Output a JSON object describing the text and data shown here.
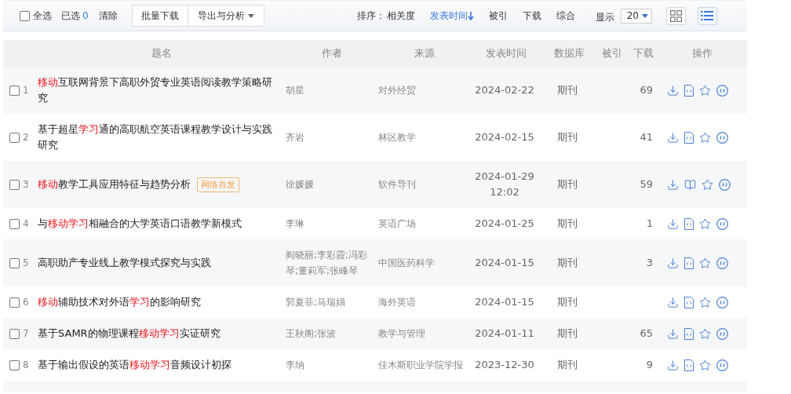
{
  "toolbar": {
    "select_all": {
      "label": "全选",
      "checked": false
    },
    "selected_label": "已选",
    "selected_count": "0",
    "clear": "清除",
    "buttons": [
      {
        "label": "批量下载",
        "kind": "plain"
      },
      {
        "label": "导出与分析",
        "kind": "dropdown"
      }
    ],
    "sort": {
      "label": "排序：",
      "options": [
        {
          "label": "相关度",
          "selected": false
        },
        {
          "label": "发表时间",
          "selected": true
        },
        {
          "label": "被引",
          "selected": false
        },
        {
          "label": "下载",
          "selected": false
        },
        {
          "label": "综合",
          "selected": false
        }
      ]
    },
    "display": {
      "label": "显示",
      "value": "20"
    },
    "views": [
      {
        "kind": "grid",
        "selected": false
      },
      {
        "kind": "list",
        "selected": true
      }
    ]
  },
  "table": {
    "columns": [
      "题名",
      "作者",
      "来源",
      "发表时间",
      "数据库",
      "被引",
      "下载",
      "操作"
    ],
    "rows": [
      {
        "number": "1",
        "checked": false,
        "kind": "html",
        "title": [
          {
            "text": "移动",
            "highlight": true
          },
          {
            "text": "互联网背景下高职外贸专业英语阅读教学策略研究",
            "highlight": false
          }
        ],
        "author": "胡星",
        "source": "对外经贸",
        "date": "2024-02-22",
        "database": "期刊",
        "downloads": "69"
      },
      {
        "number": "2",
        "checked": false,
        "kind": "html",
        "title": [
          {
            "text": "基于超星",
            "highlight": false
          },
          {
            "text": "学习",
            "highlight": true
          },
          {
            "text": "通的高职航空英语课程教学设计与实践研究",
            "highlight": false
          }
        ],
        "author": "齐岩",
        "source": "林区教学",
        "date": "2024-02-15",
        "database": "期刊",
        "downloads": "41"
      },
      {
        "number": "3",
        "checked": false,
        "kind": "book",
        "title": [
          {
            "text": "移动",
            "highlight": true
          },
          {
            "text": "教学工具应用特征与趋势分析",
            "highlight": false
          }
        ],
        "badge": "网络首发",
        "author": "徐媛媛",
        "source": "软件导刊",
        "date": "2024-01-29 12:02",
        "database": "期刊",
        "downloads": "59"
      },
      {
        "number": "4",
        "checked": false,
        "kind": "html",
        "title": [
          {
            "text": "与",
            "highlight": false
          },
          {
            "text": "移动学习",
            "highlight": true
          },
          {
            "text": "相融合的大学英语口语教学新模式",
            "highlight": false
          }
        ],
        "author": "李琳",
        "source": "英语广场",
        "date": "2024-01-25",
        "database": "期刊",
        "downloads": "1"
      },
      {
        "number": "5",
        "checked": false,
        "kind": "html",
        "title": [
          {
            "text": "高职助产专业线上教学模式探究与实践",
            "highlight": false
          }
        ],
        "author": "阎晓丽;李彩霞;冯彩琴;董莉军;张峰琴",
        "source": "中国医药科学",
        "date": "2024-01-15",
        "database": "期刊",
        "downloads": "3"
      },
      {
        "number": "6",
        "checked": false,
        "kind": "html",
        "title": [
          {
            "text": "移动",
            "highlight": true
          },
          {
            "text": "辅助技术对外语",
            "highlight": false
          },
          {
            "text": "学习",
            "highlight": true
          },
          {
            "text": "的影响研究",
            "highlight": false
          }
        ],
        "author": "郭夏菲;马瑞娟",
        "source": "海外英语",
        "date": "2024-01-15",
        "database": "期刊"
      },
      {
        "number": "7",
        "checked": false,
        "kind": "html",
        "title": [
          {
            "text": "基于SAMR的物理课程",
            "highlight": false
          },
          {
            "text": "移动学习",
            "highlight": true
          },
          {
            "text": "实证研究",
            "highlight": false
          }
        ],
        "author": "王秋阁;张波",
        "source": "教学与管理",
        "date": "2024-01-11",
        "database": "期刊",
        "downloads": "65"
      },
      {
        "number": "8",
        "checked": false,
        "kind": "html",
        "title": [
          {
            "text": "基于输出假设的英语",
            "highlight": false
          },
          {
            "text": "移动学习",
            "highlight": true
          },
          {
            "text": "音频设计初探",
            "highlight": false
          }
        ],
        "author": "李纳",
        "source": "佳木斯职业学院学报",
        "date": "2023-12-30",
        "database": "期刊",
        "downloads": "9"
      }
    ]
  }
}
